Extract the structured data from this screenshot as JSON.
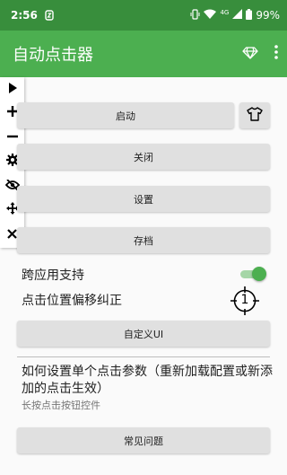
{
  "statusbar": {
    "time": "2:56",
    "network": "4G",
    "battery": "99%"
  },
  "appbar": {
    "title": "自动点击器"
  },
  "floatbar": {
    "items": [
      {
        "icon": "play-icon"
      },
      {
        "icon": "plus-icon"
      },
      {
        "icon": "minus-icon"
      },
      {
        "icon": "gear-icon"
      },
      {
        "icon": "eye-off-icon"
      },
      {
        "icon": "move-icon"
      },
      {
        "icon": "close-icon"
      }
    ]
  },
  "main": {
    "start_label": "启动",
    "close_label": "关闭",
    "settings_label": "设置",
    "archive_label": "存档",
    "cross_app_label": "跨应用支持",
    "cross_app_enabled": true,
    "offset_label": "点击位置偏移纠正",
    "target_number": "1",
    "custom_ui_label": "自定义UI",
    "info_title": "如何设置单个点击参数（重新加载配置或新添加的点击生效）",
    "info_sub": "长按点击按钮控件",
    "faq_label": "常见问题"
  },
  "colors": {
    "statusbar": "#388e3c",
    "appbar": "#4caf50",
    "accent": "#4caf50",
    "button": "#e0e0e0"
  }
}
